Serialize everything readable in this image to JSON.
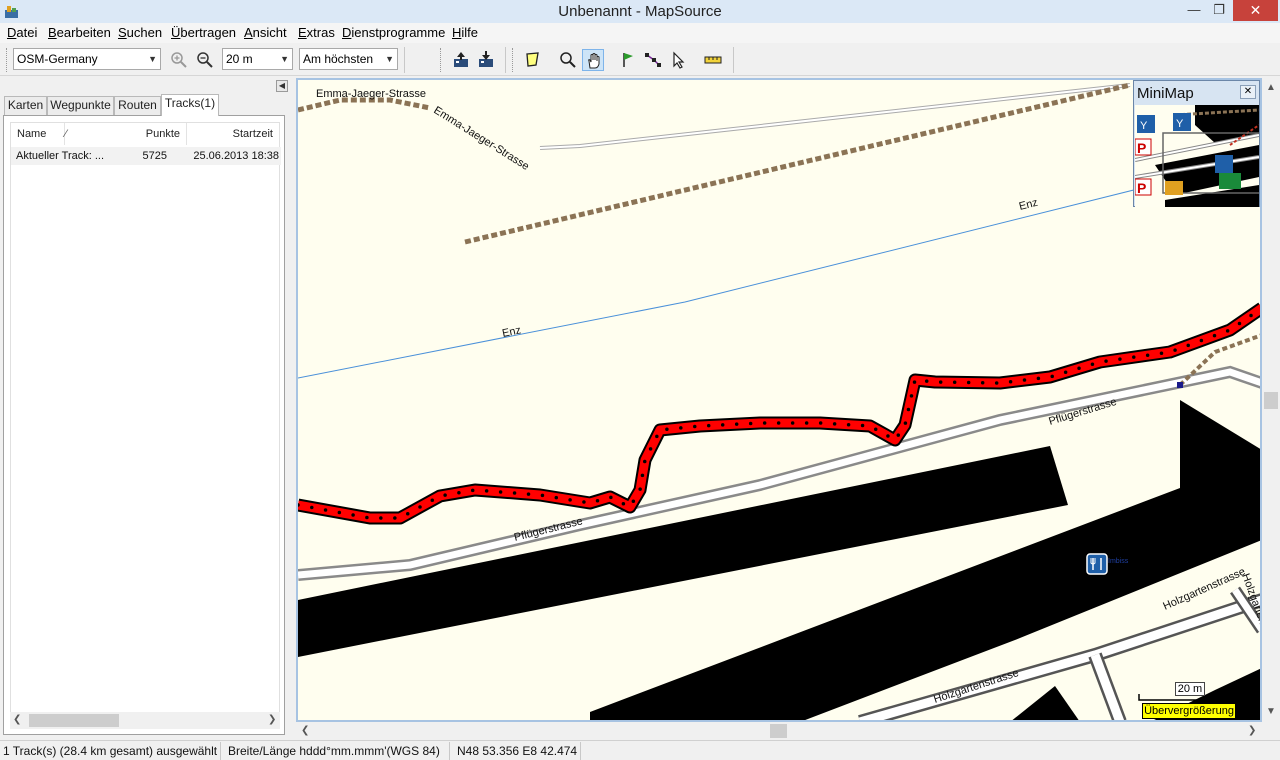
{
  "window": {
    "title": "Unbenannt - MapSource"
  },
  "menu": [
    "Datei",
    "Bearbeiten",
    "Suchen",
    "Übertragen",
    "Ansicht",
    "Extras",
    "Dienstprogramme",
    "Hilfe"
  ],
  "toolbar": {
    "map_product": "OSM-Germany",
    "zoom_level": "20 m",
    "detail_level": "Am höchsten"
  },
  "left_panel": {
    "tabs": [
      "Karten",
      "Wegpunkte",
      "Routen",
      "Tracks(1)"
    ],
    "active_tab": "Tracks(1)",
    "columns": [
      "Name",
      "⁄",
      "Punkte",
      "Startzeit"
    ],
    "rows": [
      {
        "name": "Aktueller Track: ...",
        "points": "5725",
        "start": "25.06.2013 18:38"
      }
    ]
  },
  "map": {
    "labels": {
      "emma_top": "Emma-Jaeger-Strasse",
      "emma_diag": "Emma-Jaeger-Strasse",
      "enz_1": "Enz",
      "enz_2": "Enz",
      "pflueger_1": "Pflügerstrasse",
      "pflueger_2": "Pflügerstrasse",
      "holzgarten_1": "Holzgartenstrasse",
      "holzgarten_2": "Holzgartenstrasse",
      "holzgarten_3": "Holzgartenstr"
    },
    "poi_label": "Imbiss",
    "minimap_title": "MiniMap",
    "scale": "20 m",
    "overzoom": "Übervergrößerung",
    "colors": {
      "track": "#ff0000",
      "river": "#4a90d9",
      "path": "#8b7355",
      "building": "#000000",
      "land": "#fffeef"
    }
  },
  "status": {
    "selection": "1 Track(s) (28.4 km gesamt) ausgewählt",
    "format": "Breite/Länge hddd°mm.mmm'(WGS 84)",
    "position": "N48 53.356 E8 42.474"
  }
}
